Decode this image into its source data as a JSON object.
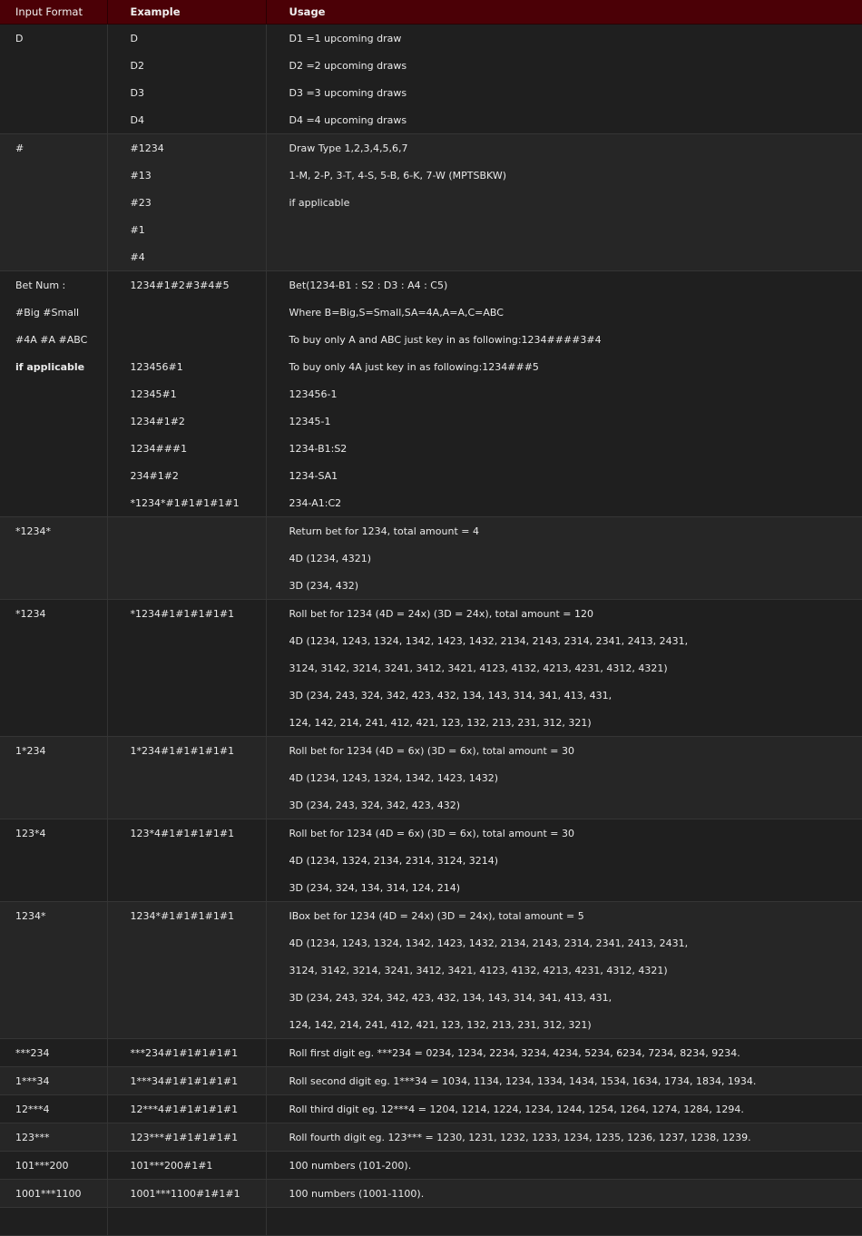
{
  "headers": [
    "Input Format",
    "Example",
    "Usage"
  ],
  "rows": [
    {
      "input": [
        "D"
      ],
      "example": [
        "D",
        "D2",
        "D3",
        "D4"
      ],
      "usage": [
        "D1 =1 upcoming draw",
        "D2 =2 upcoming draws",
        "D3 =3 upcoming draws",
        "D4 =4 upcoming draws"
      ]
    },
    {
      "input": [
        "#"
      ],
      "example": [
        "#1234",
        "#13",
        "#23",
        "#1",
        "#4"
      ],
      "usage": [
        "Draw Type 1,2,3,4,5,6,7",
        "1-M, 2-P, 3-T, 4-S, 5-B, 6-K, 7-W (MPTSBKW)",
        "if applicable"
      ]
    },
    {
      "input": [
        "Bet Num :",
        "#Big #Small",
        "#4A #A #ABC",
        "if applicable"
      ],
      "example": [
        "1234#1#2#3#4#5",
        "",
        "",
        "123456#1",
        "12345#1",
        "1234#1#2",
        "1234###1",
        "234#1#2",
        "*1234*#1#1#1#1#1"
      ],
      "usage": [
        "Bet(1234-B1 : S2 : D3 : A4 : C5)",
        "Where B=Big,S=Small,SA=4A,A=A,C=ABC",
        "To buy only A and ABC just key in as following:1234####3#4",
        "To buy only 4A just key in as following:1234###5",
        "123456-1",
        "12345-1",
        "1234-B1:S2",
        "1234-SA1",
        "234-A1:C2"
      ]
    },
    {
      "input": [
        "*1234*"
      ],
      "example": [
        ""
      ],
      "usage": [
        "Return bet for 1234, total amount = 4",
        "4D (1234, 4321)",
        "3D (234, 432)"
      ]
    },
    {
      "input": [
        "*1234"
      ],
      "example": [
        "*1234#1#1#1#1#1"
      ],
      "usage": [
        "Roll bet for 1234 (4D = 24x) (3D = 24x), total amount = 120",
        "4D (1234, 1243, 1324, 1342, 1423, 1432, 2134, 2143, 2314, 2341, 2413, 2431,",
        "3124, 3142, 3214, 3241, 3412, 3421, 4123, 4132, 4213, 4231, 4312, 4321)",
        "3D (234, 243, 324, 342, 423, 432, 134, 143, 314, 341, 413, 431,",
        "124, 142, 214, 241, 412, 421, 123, 132, 213, 231, 312, 321)"
      ]
    },
    {
      "input": [
        "1*234"
      ],
      "example": [
        "1*234#1#1#1#1#1"
      ],
      "usage": [
        "Roll bet for 1234 (4D = 6x) (3D = 6x), total amount = 30",
        "4D (1234, 1243, 1324, 1342, 1423, 1432)",
        "3D (234, 243, 324, 342, 423, 432)"
      ]
    },
    {
      "input": [
        "123*4"
      ],
      "example": [
        "123*4#1#1#1#1#1"
      ],
      "usage": [
        "Roll bet for 1234 (4D = 6x) (3D = 6x), total amount = 30",
        "4D (1234, 1324, 2134, 2314, 3124, 3214)",
        "3D (234, 324, 134, 314, 124, 214)"
      ]
    },
    {
      "input": [
        "1234*"
      ],
      "example": [
        "1234*#1#1#1#1#1"
      ],
      "usage": [
        "IBox bet for 1234 (4D = 24x) (3D = 24x), total amount = 5",
        "4D (1234, 1243, 1324, 1342, 1423, 1432, 2134, 2143, 2314, 2341, 2413, 2431,",
        "3124, 3142, 3214, 3241, 3412, 3421, 4123, 4132, 4213, 4231, 4312, 4321)",
        "3D (234, 243, 324, 342, 423, 432, 134, 143, 314, 341, 413, 431,",
        "124, 142, 214, 241, 412, 421, 123, 132, 213, 231, 312, 321)"
      ]
    },
    {
      "input": [
        "***234"
      ],
      "example": [
        "***234#1#1#1#1#1"
      ],
      "usage": [
        "Roll first digit eg. ***234 = 0234, 1234, 2234, 3234, 4234, 5234, 6234, 7234, 8234, 9234."
      ]
    },
    {
      "input": [
        "1***34"
      ],
      "example": [
        "1***34#1#1#1#1#1"
      ],
      "usage": [
        "Roll second digit eg. 1***34 = 1034, 1134, 1234, 1334, 1434, 1534, 1634, 1734, 1834, 1934."
      ]
    },
    {
      "input": [
        "12***4"
      ],
      "example": [
        "12***4#1#1#1#1#1"
      ],
      "usage": [
        "Roll third digit eg. 12***4 = 1204, 1214, 1224, 1234, 1244, 1254, 1264, 1274, 1284, 1294."
      ]
    },
    {
      "input": [
        "123***"
      ],
      "example": [
        "123***#1#1#1#1#1"
      ],
      "usage": [
        "Roll fourth digit eg. 123*** = 1230, 1231, 1232, 1233, 1234, 1235, 1236, 1237, 1238, 1239."
      ]
    },
    {
      "input": [
        "101***200"
      ],
      "example": [
        "101***200#1#1"
      ],
      "usage": [
        "100 numbers (101-200)."
      ]
    },
    {
      "input": [
        "1001***1100"
      ],
      "example": [
        "1001***1100#1#1#1"
      ],
      "usage": [
        "100 numbers (1001-1100)."
      ]
    },
    {
      "input": [
        ""
      ],
      "example": [
        ""
      ],
      "usage": [
        ""
      ]
    }
  ]
}
